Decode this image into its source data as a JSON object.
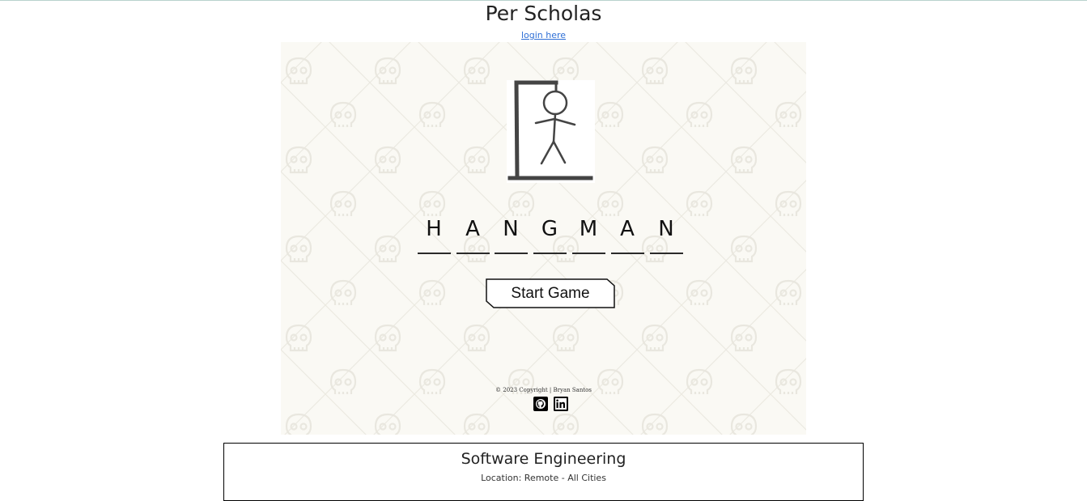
{
  "page": {
    "title": "Per Scholas",
    "login_link": "login here"
  },
  "game": {
    "title_letters": [
      "H",
      "A",
      "N",
      "G",
      "M",
      "A",
      "N"
    ],
    "start_button_label": "Start Game",
    "copyright": "© 2023 Copyright | Bryan Santos",
    "social_icons": [
      "github-icon",
      "linkedin-icon"
    ]
  },
  "course": {
    "title": "Software Engineering",
    "location": "Location: Remote - All Cities"
  },
  "colors": {
    "frame_background": "#faf9f4",
    "skull_pattern": "#ebe9e1",
    "gallows": "#444444",
    "link": "#2f6fd6"
  }
}
